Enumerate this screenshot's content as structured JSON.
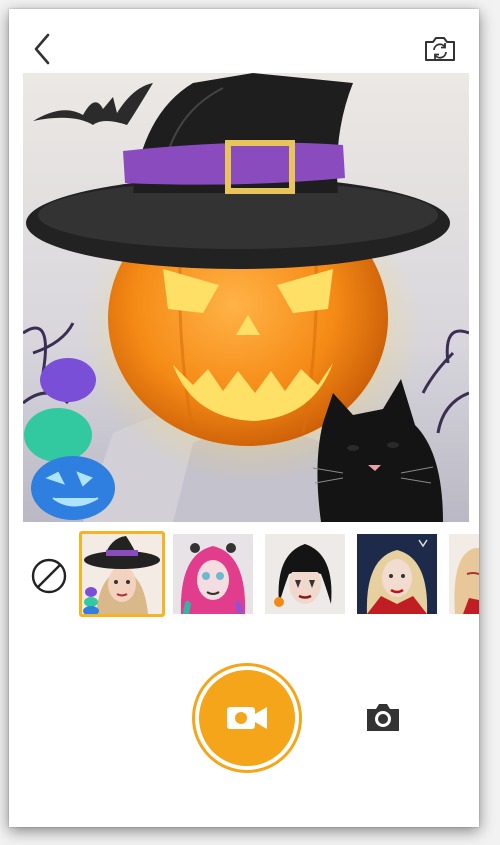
{
  "colors": {
    "accent": "#f5a51a",
    "selected_border": "#f5b426",
    "icon": "#333333"
  },
  "topbar": {
    "back_icon": "chevron-left-icon",
    "flip_camera_icon": "camera-flip-icon"
  },
  "preview": {
    "effect": "halloween-witch-pumpkin"
  },
  "filters": {
    "none_icon": "no-filter-icon",
    "items": [
      {
        "id": "witch",
        "selected": true
      },
      {
        "id": "pink-hair-skull",
        "selected": false
      },
      {
        "id": "gothic",
        "selected": false
      },
      {
        "id": "vampire",
        "selected": false
      },
      {
        "id": "devil",
        "selected": false
      }
    ]
  },
  "controls": {
    "record_icon": "video-camera-icon",
    "photo_icon": "camera-icon"
  }
}
